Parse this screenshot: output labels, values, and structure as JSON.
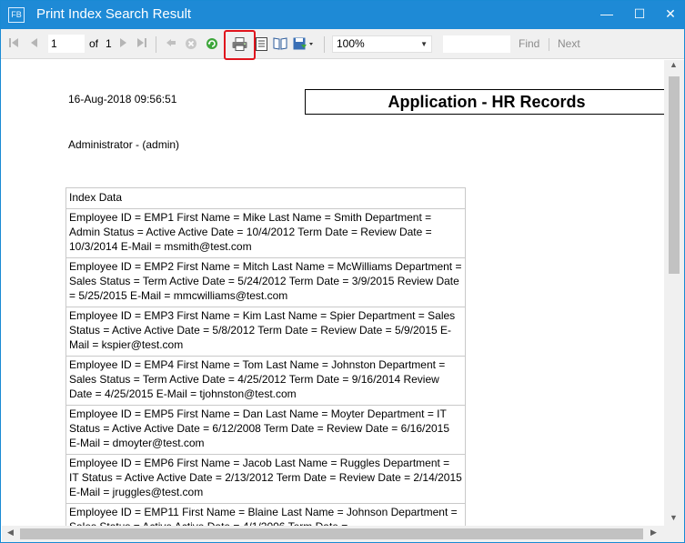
{
  "window": {
    "title": "Print Index Search Result",
    "app_icon_text": "FB",
    "minimize_glyph": "—",
    "maximize_glyph": "☐",
    "close_glyph": "✕"
  },
  "toolbar": {
    "page_current": "1",
    "page_of_label": "of",
    "page_total": "1",
    "zoom_value": "100%",
    "search_value": "",
    "find_label": "Find",
    "next_label": "Next",
    "icons": {
      "first_page": "first-page-icon",
      "prev_page": "previous-page-icon",
      "next_page": "next-page-icon",
      "last_page": "last-page-icon",
      "back": "back-icon",
      "stop": "stop-icon",
      "refresh": "refresh-icon",
      "print": "print-icon",
      "print_layout": "print-layout-icon",
      "page_setup": "page-setup-icon",
      "export": "export-icon"
    },
    "highlight_color": "#e0141d"
  },
  "report": {
    "print_date": "16-Aug-2018 09:56:51",
    "title": "Application - HR Records",
    "user": "Administrator - (admin)",
    "table_header": "Index Data",
    "rows": [
      "Employee ID = EMP1 First Name = Mike Last Name = Smith Department = Admin Status = Active Active Date = 10/4/2012 Term Date =  Review Date = 10/3/2014 E-Mail = msmith@test.com",
      "Employee ID = EMP2 First Name = Mitch Last Name = McWilliams Department = Sales Status = Term Active Date = 5/24/2012 Term Date = 3/9/2015 Review Date = 5/25/2015 E-Mail = mmcwilliams@test.com",
      "Employee ID = EMP3 First Name = Kim Last Name = Spier Department = Sales Status = Active Active Date = 5/8/2012 Term Date =  Review Date = 5/9/2015 E-Mail = kspier@test.com",
      "Employee ID = EMP4 First Name = Tom Last Name = Johnston Department = Sales Status = Term Active Date = 4/25/2012 Term Date = 9/16/2014 Review Date = 4/25/2015 E-Mail = tjohnston@test.com",
      "Employee ID = EMP5 First Name = Dan Last Name = Moyter Department = IT Status = Active Active Date = 6/12/2008 Term Date =  Review Date = 6/16/2015 E-Mail = dmoyter@test.com",
      "Employee ID = EMP6 First Name = Jacob Last Name = Ruggles Department = IT Status = Active Active Date = 2/13/2012 Term Date = Review Date = 2/14/2015 E-Mail = jruggles@test.com",
      "Employee ID = EMP11 First Name = Blaine Last Name = Johnson Department = Sales Status = Active Active Date = 4/1/2006 Term Date ="
    ]
  },
  "colors": {
    "title_bar": "#1e8ad6",
    "toolbar": "#f0f0f0"
  }
}
